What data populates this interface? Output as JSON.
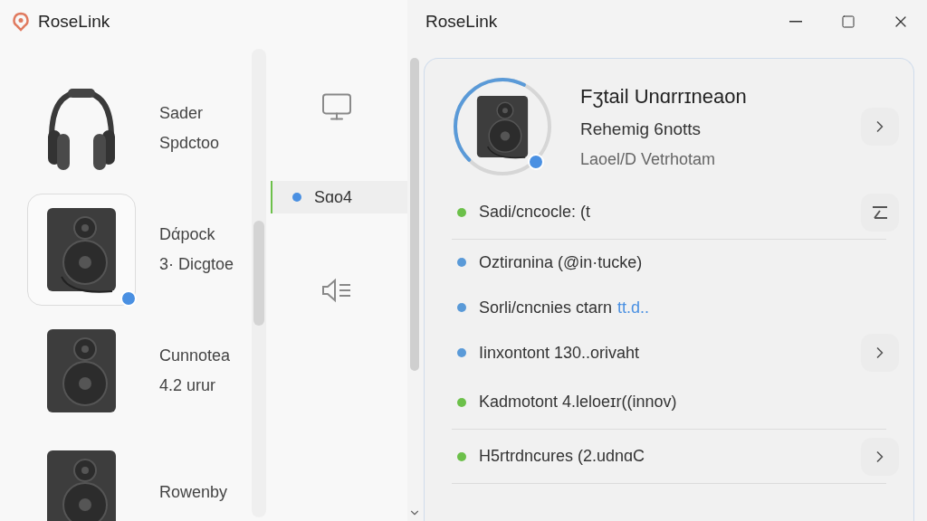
{
  "app": {
    "title": "RoseLink"
  },
  "window": {
    "title": "RoseLink"
  },
  "devices": [
    {
      "kind": "headphones",
      "name": "Sader",
      "detail": "Spdctoo",
      "selected": false
    },
    {
      "kind": "speaker",
      "name": "Dάpock",
      "detail": "3· Dicgtoe",
      "selected": true
    },
    {
      "kind": "speaker",
      "name": "Cunnotea",
      "detail": "4.2 urur",
      "selected": false
    },
    {
      "kind": "speaker",
      "name": "Rowenby",
      "selected": false
    }
  ],
  "nav": [
    {
      "kind": "monitor",
      "selected": false
    },
    {
      "kind": "item",
      "label": "Sɑo4",
      "selected": true
    },
    {
      "kind": "sound-list",
      "selected": false
    }
  ],
  "detail": {
    "title": "Fʒtail Unɑrrɪneaon",
    "subtitle": "Rehemig 6notts",
    "caption": "Laoel/D Vetrhotam",
    "ring": {
      "level": 0.45
    },
    "rows": [
      {
        "text": "Sadi/cncocle: (t",
        "color": "#6cc04a",
        "kind": "menu",
        "divider": true
      },
      {
        "text": "Oztirɑnina (@in·tucke)",
        "color": "#5a9ad8",
        "divider": false
      },
      {
        "text": "Sorli/cncnies ctarn",
        "link": "tt.d..",
        "color": "#5a9ad8",
        "divider": false
      },
      {
        "text": "Iinxontont 130..orivaht",
        "color": "#5a9ad8",
        "kind": "chevron",
        "divider": false
      },
      {
        "text": "Kadmotont 4.leloeɪr((innov)",
        "color": "#6cc04a",
        "divider": true
      },
      {
        "text": "H5rtrdncures (2.udnɑC",
        "color": "#6cc04a",
        "kind": "chevron",
        "divider": true
      }
    ]
  }
}
